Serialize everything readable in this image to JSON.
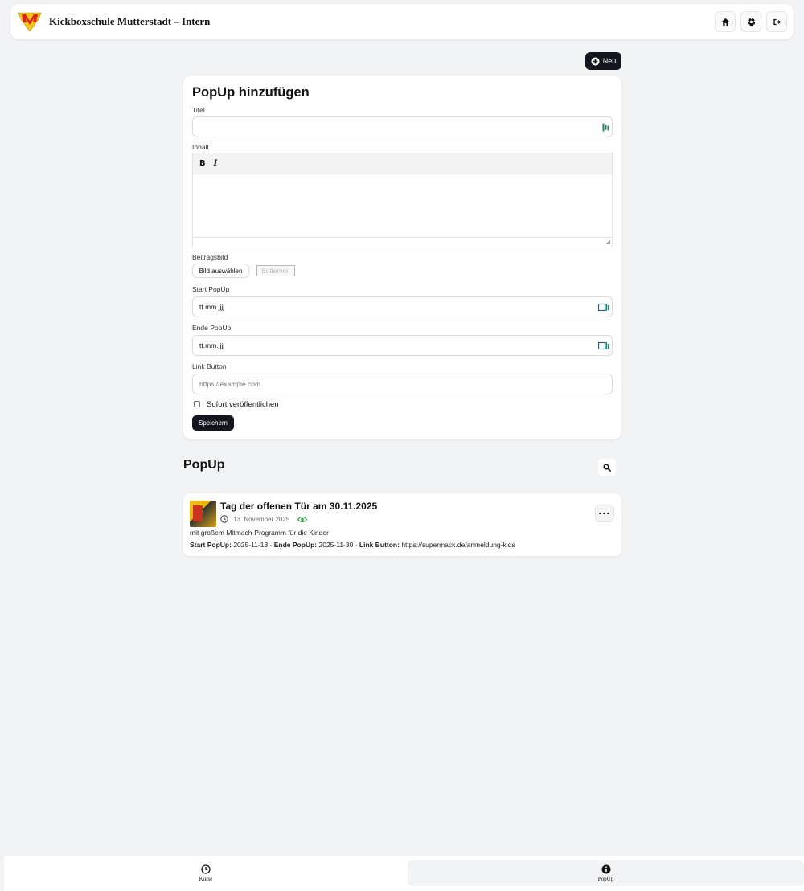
{
  "header": {
    "title": "Kickboxschule Mutterstadt – Intern",
    "logo_letter": "M"
  },
  "toolbar": {
    "new_label": "Neu"
  },
  "form": {
    "heading": "PopUp hinzufügen",
    "title_label": "Titel",
    "title_value": "",
    "content_label": "Inhalt",
    "bold_label": "B",
    "italic_label": "I",
    "image_label": "Beitragsbild",
    "choose_image_label": "Bild auswählen",
    "remove_image_label": "Entfernen",
    "start_label": "Start PopUp",
    "start_value": "tt.mm.jjjj",
    "end_label": "Ende PopUp",
    "end_value": "tt.mm.jjjj",
    "link_label": "Link Button",
    "link_placeholder": "https://example.com",
    "publish_label": "Sofort veröffentlichen",
    "publish_checked": false,
    "save_label": "Speichern"
  },
  "list": {
    "heading": "PopUp",
    "items": [
      {
        "title": "Tag der offenen Tür am 30.11.2025",
        "date": "13. November 2025",
        "visible": true,
        "description": "mit großem Mitmach-Programm für die Kinder",
        "start_key": "Start PopUp:",
        "start_value": "2025-11-13",
        "end_key": "Ende PopUp:",
        "end_value": "2025-11-30",
        "link_key": "Link Button:",
        "link_value": "https://supermack.de/anmeldung-kids",
        "more_label": "···"
      }
    ]
  },
  "bottom_nav": {
    "items": [
      {
        "label": "Kurse",
        "icon": "clock-icon",
        "active": false
      },
      {
        "label": "PopUp",
        "icon": "info-icon",
        "active": true
      }
    ]
  },
  "colors": {
    "primary_dark": "#14161f",
    "background": "#f2f3f5",
    "eye_green": "#2e9c4b",
    "logo_red": "#d8261c",
    "logo_yellow": "#f5c518"
  }
}
